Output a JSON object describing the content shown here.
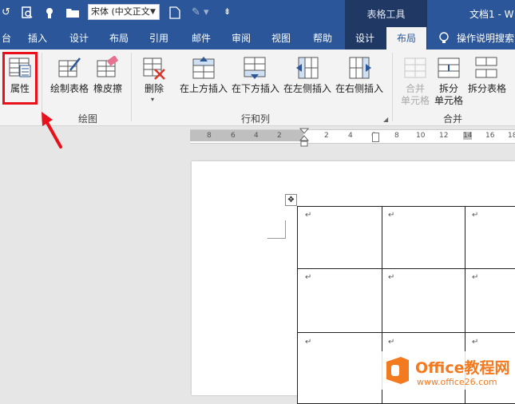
{
  "titlebar": {
    "font_name": "宋体 (中文正文",
    "contextual_tab_group": "表格工具",
    "document_title": "文档1 - W"
  },
  "tabs": [
    {
      "label": "台"
    },
    {
      "label": "插入"
    },
    {
      "label": "设计"
    },
    {
      "label": "布局"
    },
    {
      "label": "引用"
    },
    {
      "label": "邮件"
    },
    {
      "label": "审阅"
    },
    {
      "label": "视图"
    },
    {
      "label": "帮助"
    },
    {
      "label": "设计"
    },
    {
      "label": "布局",
      "active": true
    }
  ],
  "tell_me": "操作说明搜索",
  "ribbon": {
    "properties": "属性",
    "draw_table": "绘制表格",
    "eraser": "橡皮擦",
    "delete": "删除",
    "insert_above": "在上方插入",
    "insert_below": "在下方插入",
    "insert_left": "在左侧插入",
    "insert_right": "在右侧插入",
    "merge_cells_1": "合并",
    "merge_cells_2": "单元格",
    "split_cells_1": "拆分",
    "split_cells_2": "单元格",
    "split_table": "拆分表格",
    "groups": {
      "draw": "绘图",
      "rows_cols": "行和列",
      "merge": "合并"
    }
  },
  "ruler_ticks": [
    "8",
    "6",
    "4",
    "2",
    "2",
    "4",
    "6",
    "8",
    "10",
    "12",
    "14",
    "16",
    "18"
  ],
  "cell_mark": "↵",
  "watermark": {
    "brand": "Office教程网",
    "url": "www.office26.com"
  },
  "colors": {
    "title_blue": "#2b579a",
    "context_dark": "#203864",
    "highlight_red": "#e8101a",
    "logo_orange": "#f47a20"
  },
  "icons": [
    "undo-icon",
    "print-preview-icon",
    "touch-mode-icon",
    "open-folder-icon",
    "new-doc-icon",
    "format-painter-icon",
    "customize-icon",
    "lightbulb-icon",
    "properties-icon",
    "draw-table-icon",
    "eraser-icon",
    "delete-table-icon",
    "insert-above-icon",
    "insert-below-icon",
    "insert-left-icon",
    "insert-right-icon",
    "merge-cells-icon",
    "split-cells-icon",
    "split-table-icon",
    "table-move-handle-icon",
    "red-arrow-icon"
  ]
}
